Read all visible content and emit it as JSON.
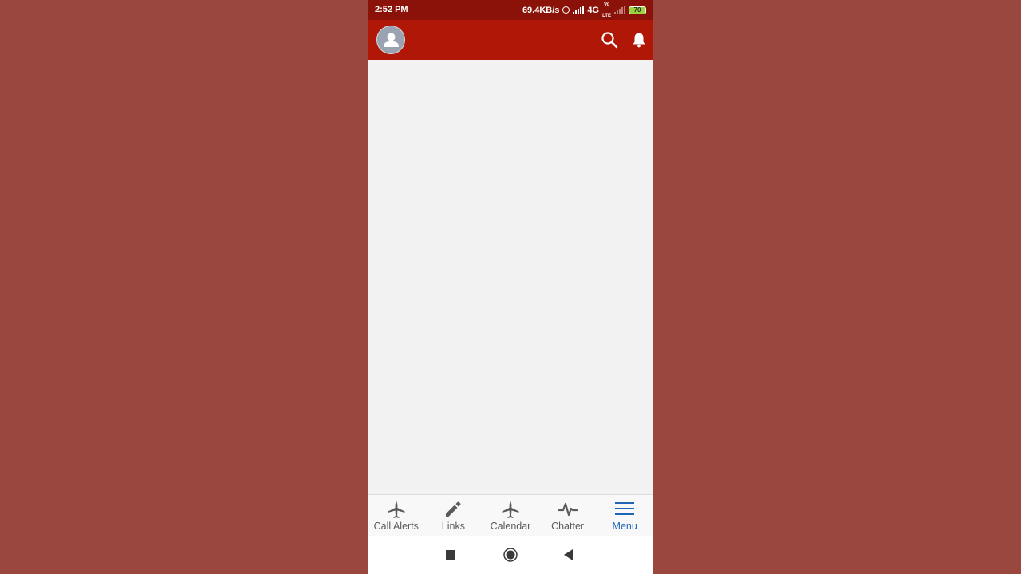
{
  "status_bar": {
    "time": "2:52 PM",
    "speed": "69.4KB/s",
    "network": "4G",
    "volte_top": "Vo",
    "volte_bottom": "LTE",
    "battery": "70"
  },
  "header": {
    "avatar_icon": "user-icon",
    "search_icon": "search-icon",
    "notifications_icon": "bell-icon",
    "background": "#b01707"
  },
  "tabs": [
    {
      "label": "Call Alerts",
      "icon": "airplane-icon",
      "active": false
    },
    {
      "label": "Links",
      "icon": "pencil-icon",
      "active": false
    },
    {
      "label": "Calendar",
      "icon": "airplane-icon",
      "active": false
    },
    {
      "label": "Chatter",
      "icon": "pulse-icon",
      "active": false
    },
    {
      "label": "Menu",
      "icon": "hamburger-icon",
      "active": true
    }
  ],
  "nav": {
    "recents_icon": "square-icon",
    "home_icon": "circle-icon",
    "back_icon": "triangle-back-icon"
  },
  "colors": {
    "page_background": "#9a4740",
    "status_bar": "#8b1208",
    "accent_active": "#1f66b7",
    "tab_inactive": "#5a5a5a"
  }
}
